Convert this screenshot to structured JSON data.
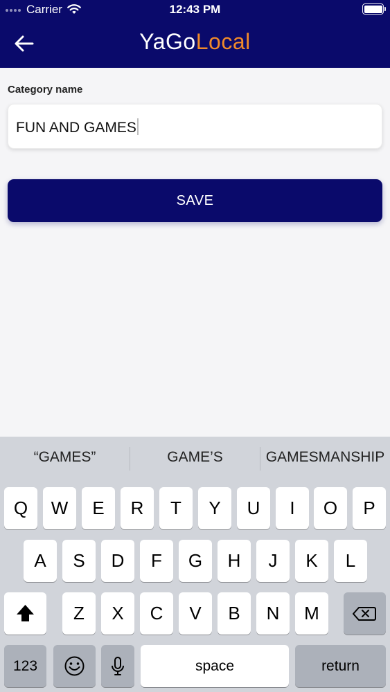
{
  "status_bar": {
    "carrier": "Carrier",
    "time": "12:43 PM"
  },
  "header": {
    "back_icon": "arrow-left-icon",
    "logo_part1": "YaGo",
    "logo_part2": "Local",
    "background_color": "#0a0a6b",
    "logo_accent_color": "#f08a2a"
  },
  "form": {
    "category_label": "Category name",
    "category_value": "FUN AND GAMES",
    "save_label": "SAVE"
  },
  "keyboard": {
    "suggestions": [
      "“GAMES”",
      "GAME’S",
      "GAMESMANSHIP"
    ],
    "row1": [
      "Q",
      "W",
      "E",
      "R",
      "T",
      "Y",
      "U",
      "I",
      "O",
      "P"
    ],
    "row2": [
      "A",
      "S",
      "D",
      "F",
      "G",
      "H",
      "J",
      "K",
      "L"
    ],
    "row3": [
      "Z",
      "X",
      "C",
      "V",
      "B",
      "N",
      "M"
    ],
    "numbers_label": "123",
    "space_label": "space",
    "return_label": "return",
    "shift_icon": "shift-icon",
    "delete_icon": "delete-icon",
    "emoji_icon": "emoji-icon",
    "mic_icon": "microphone-icon"
  }
}
